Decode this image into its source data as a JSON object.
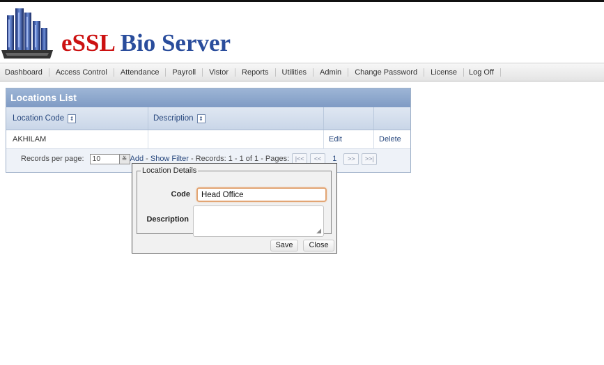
{
  "header": {
    "brand_e": "eSSL",
    "brand_rest": " Bio Server",
    "logo_icon": "buildings-logo-icon"
  },
  "menu": [
    "Dashboard",
    "Access Control",
    "Attendance",
    "Payroll",
    "Vistor",
    "Reports",
    "Utilities",
    "Admin",
    "Change Password",
    "License",
    "Log Off"
  ],
  "locations": {
    "title": "Locations List",
    "columns": {
      "code": "Location Code",
      "description": "Description"
    },
    "rows": [
      {
        "code": "AKHILAM",
        "description": "",
        "edit": "Edit",
        "delete": "Delete"
      }
    ],
    "pager": {
      "records_label": "Records per page:",
      "per_page": "10",
      "add": "Add",
      "sep1": " - ",
      "show_filter": "Show Filter",
      "records_text": " - Records: 1 - 1 of 1 - Pages:",
      "current_page": "1"
    }
  },
  "dialog": {
    "legend": "Location Details",
    "code_label": "Code",
    "code_value": "Head Office",
    "description_label": "Description",
    "save": "Save",
    "close": "Close"
  }
}
